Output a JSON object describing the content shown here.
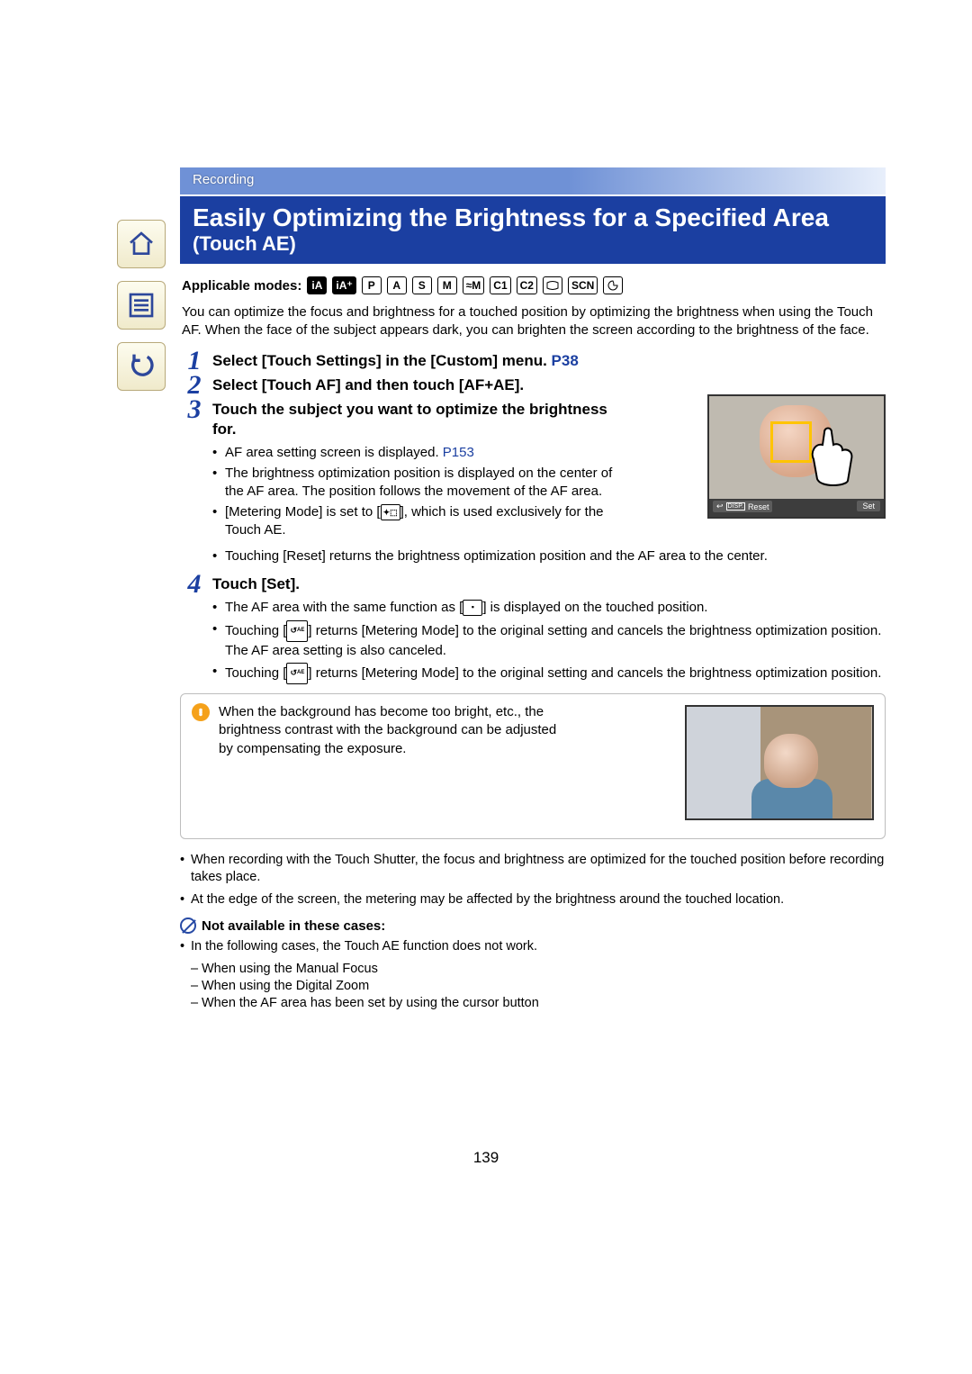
{
  "page_number": "139",
  "section_label": "Recording",
  "title": {
    "main": "Easily Optimizing the Brightness for a Specified Area ",
    "sub": "(Touch AE)"
  },
  "applicable_label": "Applicable modes:",
  "modes": [
    "iA",
    "iA+",
    "P",
    "A",
    "S",
    "M",
    "≈M",
    "C1",
    "C2",
    "□",
    "SCN",
    "🎨"
  ],
  "intro": "You can optimize the focus and brightness for a touched position by optimizing the brightness when using the Touch AF. When the face of the subject appears dark, you can brighten the screen according to the brightness of the face.",
  "steps": [
    {
      "num": "1",
      "title_pre": "Select [Touch Settings] in the [Custom] menu. ",
      "title_link": "P38"
    },
    {
      "num": "2",
      "title_pre": "Select [Touch AF] and then touch [AF+AE].",
      "title_link": ""
    },
    {
      "num": "3",
      "title_pre": "Touch the subject you want to optimize the brightness for.",
      "title_link": "",
      "bullets": [
        {
          "text_pre": "AF area setting screen is displayed. ",
          "link": "P153",
          "text_post": ""
        },
        {
          "text_pre": "The brightness optimization position is displayed on the center of the AF area. The position follows the movement of the AF area.",
          "link": "",
          "text_post": ""
        },
        {
          "text_pre": "[Metering Mode] is set to [",
          "chip": "meter-ae",
          "text_post": "], which is used exclusively for the Touch AE."
        },
        {
          "text_pre": "Touching [Reset] returns the brightness optimization position and the AF area to the center.",
          "link": "",
          "text_post": ""
        }
      ],
      "image": {
        "disp_label": "DISP.",
        "reset_label": "Reset",
        "set_label": "Set"
      }
    },
    {
      "num": "4",
      "title_pre": "Touch [Set].",
      "title_link": "",
      "bullets": [
        {
          "text_pre": "The AF area with the same function as [",
          "chip": "af-box",
          "text_post": "] is displayed on the touched position."
        },
        {
          "text_pre": "Touching [",
          "chip": "cancel-ae-1",
          "text_post": "] returns [Metering Mode] to the original setting and cancels the brightness optimization position. The AF area setting is also canceled."
        },
        {
          "text_pre": "Touching [",
          "chip": "cancel-ae-2",
          "text_post": "] returns [Metering Mode] to the original setting and cancels the brightness optimization position."
        }
      ]
    }
  ],
  "tip_text": "When the background has become too bright, etc., the brightness contrast with the background can be adjusted by compensating the exposure.",
  "notes": {
    "bullets": [
      "When recording with the Touch Shutter, the focus and brightness are optimized for the touched position before recording takes place.",
      "At the edge of the screen, the metering may be affected by the brightness around the touched location."
    ],
    "na_header": "Not available in these cases:",
    "na_intro": "In the following cases, the Touch AE function does not work.",
    "na_items": [
      "When using the Manual Focus",
      "When using the Digital Zoom",
      "When the AF area has been set by using the cursor button"
    ]
  }
}
